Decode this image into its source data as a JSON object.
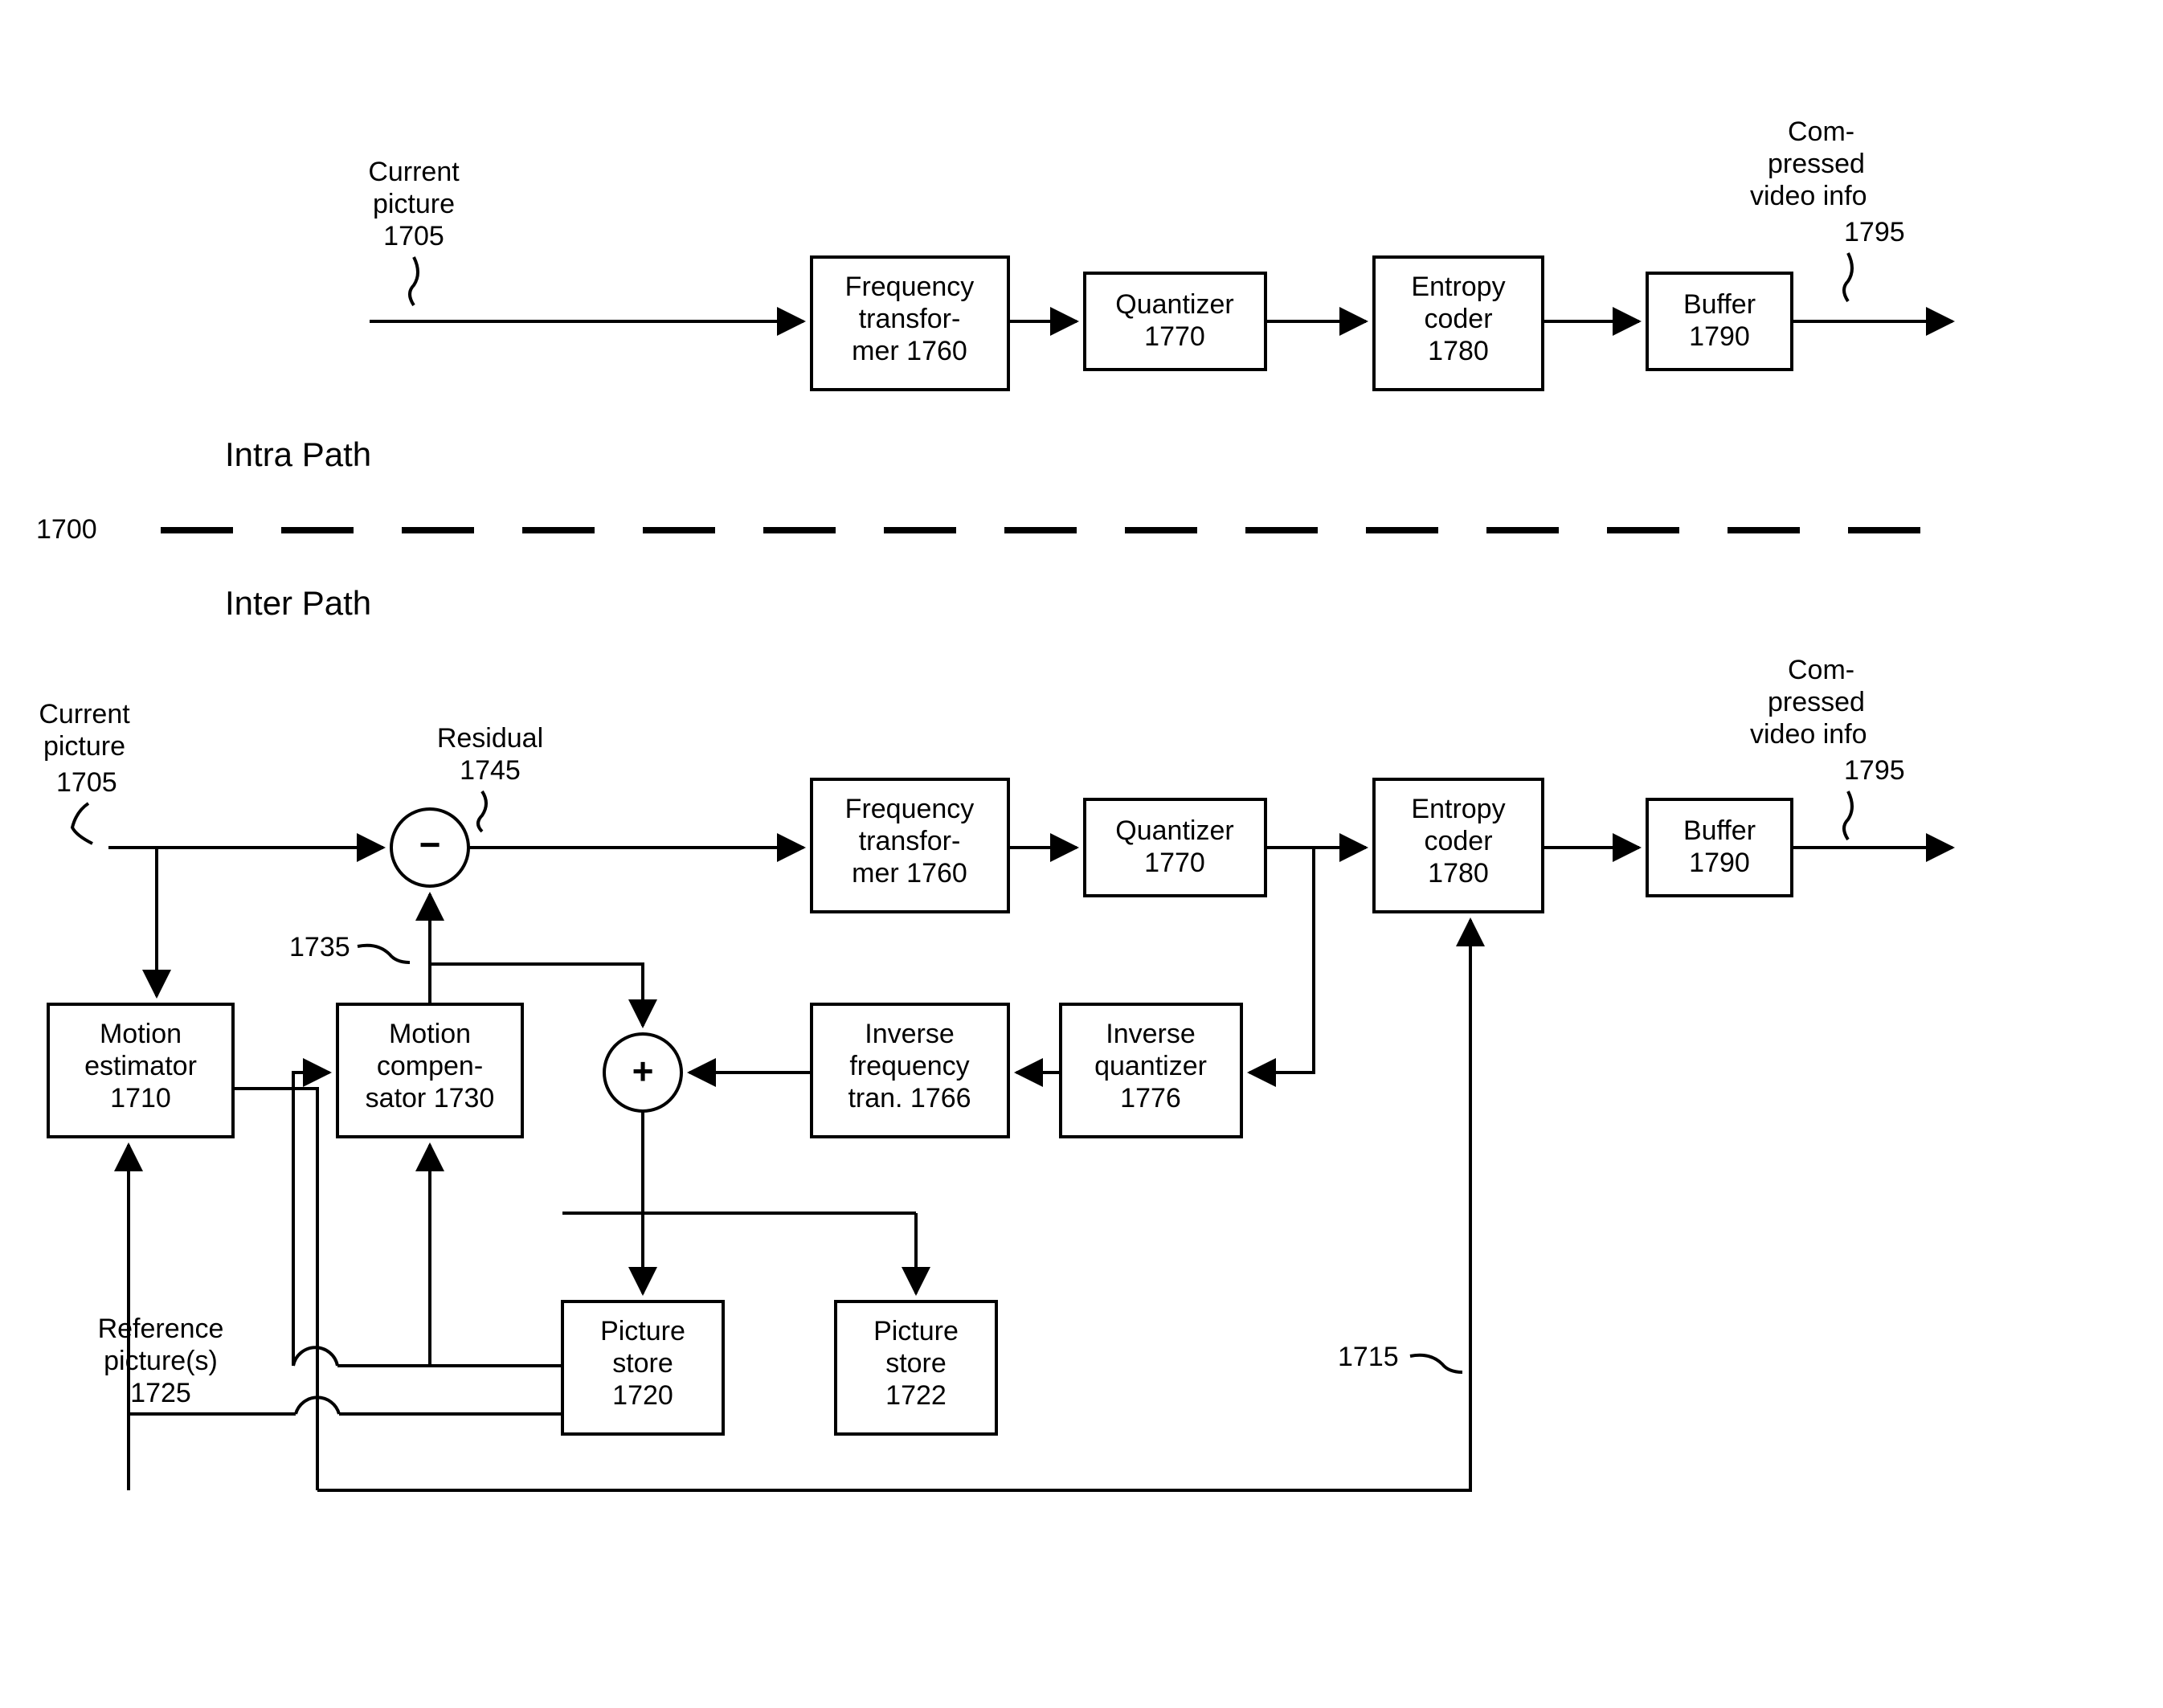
{
  "figureNumber": "1700",
  "intra": {
    "title": "Intra Path",
    "inputLabel1": "Current",
    "inputLabel2": "picture",
    "inputRef": "1705",
    "freq1": "Frequency",
    "freq2": "transfor-",
    "freq3": "mer 1760",
    "quant1": "Quantizer",
    "quant2": "1770",
    "ent1": "Entropy",
    "ent2": "coder",
    "ent3": "1780",
    "buf1": "Buffer",
    "buf2": "1790",
    "out1": "Com-",
    "out2": "pressed",
    "out3": "video info",
    "outRef": "1795"
  },
  "inter": {
    "title": "Inter Path",
    "inputLabel1": "Current",
    "inputLabel2": "picture",
    "inputRef": "1705",
    "residual1": "Residual",
    "residualRef": "1745",
    "compRef": "1735",
    "me1": "Motion",
    "me2": "estimator",
    "me3": "1710",
    "mc1": "Motion",
    "mc2": "compen-",
    "mc3": "sator 1730",
    "freq1": "Frequency",
    "freq2": "transfor-",
    "freq3": "mer 1760",
    "quant1": "Quantizer",
    "quant2": "1770",
    "ent1": "Entropy",
    "ent2": "coder",
    "ent3": "1780",
    "buf1": "Buffer",
    "buf2": "1790",
    "out1": "Com-",
    "out2": "pressed",
    "out3": "video info",
    "outRef": "1795",
    "ift1": "Inverse",
    "ift2": "frequency",
    "ift3": "tran. 1766",
    "iq1": "Inverse",
    "iq2": "quantizer",
    "iq3": "1776",
    "ps1a": "Picture",
    "ps1b": "store",
    "ps1c": "1720",
    "ps2a": "Picture",
    "ps2b": "store",
    "ps2c": "1722",
    "ref1": "Reference",
    "ref2": "picture(s)",
    "refRef": "1725",
    "mvRef": "1715"
  }
}
